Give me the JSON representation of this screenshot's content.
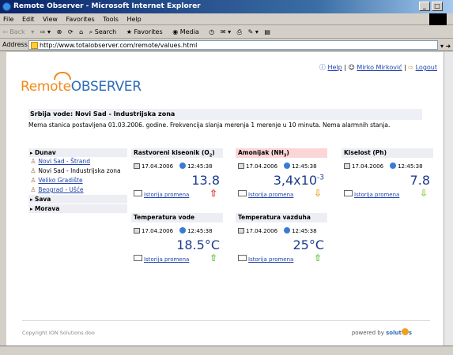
{
  "window": {
    "title": "Remote Observer - Microsoft Internet Explorer"
  },
  "menu": [
    "File",
    "Edit",
    "View",
    "Favorites",
    "Tools",
    "Help"
  ],
  "toolbar": {
    "back": "Back",
    "search": "Search",
    "favorites": "Favorites",
    "media": "Media"
  },
  "address": {
    "label": "Address",
    "url": "http://www.totalobserver.com/remote/values.html",
    "go": "Go"
  },
  "top_links": {
    "help": "Help",
    "user": "Mirko Mirković",
    "logout": "Logout"
  },
  "logo": {
    "remote": "Remote",
    "observer": "OBSERVER"
  },
  "page": {
    "title": "Srbija vode: Novi Sad - Industrijska zona",
    "description": "Merna stanica postavljena 01.03.2006. godine. Frekvencija slanja merenja 1 merenje u 10 minuta. Nema alarmnih stanja."
  },
  "sidebar": {
    "regions": [
      "Dunav",
      "Sava",
      "Morava"
    ],
    "stations": [
      {
        "label": "Novi Sad - Štrand",
        "link": true
      },
      {
        "label": "Novi Sad - Industrijska zona",
        "link": false
      },
      {
        "label": "Veliko Gradište",
        "link": true
      },
      {
        "label": "Beograd - Ušće",
        "link": true
      }
    ]
  },
  "cards": [
    {
      "title": "Rastvoreni kiseonik (O2)",
      "date": "17.04.2006",
      "time": "12:45:38",
      "value": "13.8",
      "history": "Istorija promena",
      "arrow": "⇧",
      "warn": false
    },
    {
      "title": "Amonijak (NH3)",
      "date": "17.04.2006",
      "time": "12:45:38",
      "value": "3,4x10-3",
      "history": "Istorija promena",
      "arrow": "⇩",
      "warn": true
    },
    {
      "title": "Kiselost (Ph)",
      "date": "17.04.2006",
      "time": "12:45:38",
      "value": "7.8",
      "history": "Istorija promena",
      "arrow": "⇩",
      "warn": false
    },
    {
      "title": "Temperatura vode",
      "date": "17.04.2006",
      "time": "12:45:38",
      "value": "18.5°C",
      "history": "Istorija promena",
      "arrow": "⇧",
      "warn": false
    },
    {
      "title": "Temperatura vazduha",
      "date": "17.04.2006",
      "time": "12:45:38",
      "value": "25°C",
      "history": "Istorija promena",
      "arrow": "⇧",
      "warn": false
    }
  ],
  "footer": {
    "copyright": "Copyright ION Solutions doo",
    "powered": "powered by",
    "brand_a": "solut",
    "brand_b": "s"
  }
}
